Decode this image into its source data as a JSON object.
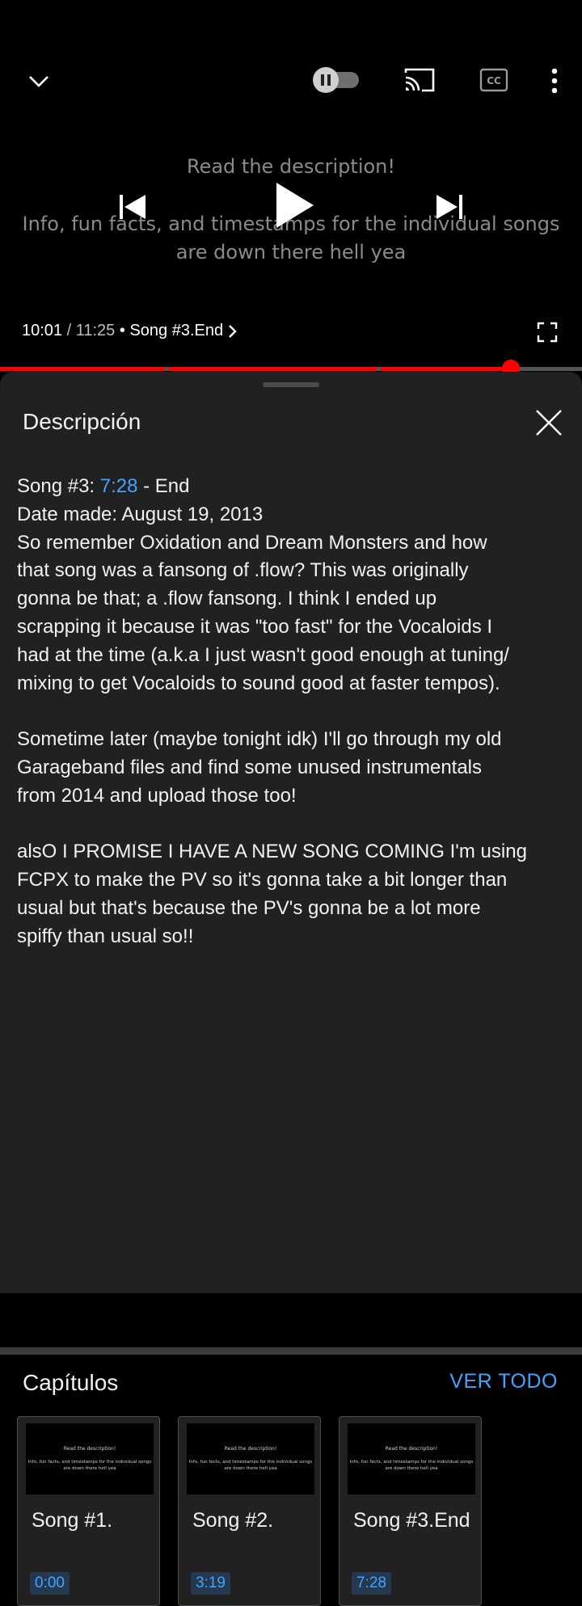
{
  "colors": {
    "accent_red": "#ff0000",
    "link_blue": "#3ea6ff",
    "panel_bg": "#212121"
  },
  "player": {
    "icons": [
      "chevron-down-icon",
      "pause-icon",
      "cast-icon",
      "closed-captions-icon",
      "more-vert-icon",
      "skip-previous-icon",
      "play-icon",
      "skip-next-icon",
      "fullscreen-icon"
    ],
    "autoplay_toggle_on": false,
    "caption_lines": [
      "Read the description!",
      "Info, fun facts, and timestamps for the individual songs",
      "are down there hell yea"
    ],
    "current_time": "10:01",
    "separator": " / ",
    "duration": "11:25",
    "chapter_bullet": " • ",
    "current_chapter": "Song #3.End",
    "progress_fraction": 0.8774
  },
  "panel": {
    "title": "Descripción",
    "description": {
      "song_prefix": "Song #3: ",
      "song_time_link": "7:28",
      "song_suffix": " - End",
      "lines": [
        "Date made: August 19, 2013",
        "So remember Oxidation and Dream Monsters and how",
        "that song was a fansong of .flow? This was originally",
        "gonna be that; a .flow fansong. I think I ended up",
        "scrapping it because it was \"too fast\" for the Vocaloids I",
        "had at the time (a.k.a I just wasn't good enough at tuning/",
        "mixing to get Vocaloids to sound good at faster tempos).",
        "",
        "Sometime later (maybe tonight idk) I'll go through my old",
        "Garageband files and find some unused instrumentals",
        "from 2014 and upload those too!",
        "",
        "alsO I PROMISE I HAVE A NEW SONG COMING I'm using",
        "FCPX to make the PV so it's gonna take a bit longer than",
        "usual but that's because the PV's gonna be a lot more",
        "spiffy than usual so!!"
      ]
    },
    "chapters_title": "Capítulos",
    "see_all": "VER TODO",
    "chapters": [
      {
        "title": "Song #1.",
        "time": "0:00",
        "thumb_line1": "Read the description!",
        "thumb_line2": "Info, fun facts, and timestamps for the individual songs",
        "thumb_line3": "are down there hell yea"
      },
      {
        "title": "Song #2.",
        "time": "3:19",
        "thumb_line1": "Read the description!",
        "thumb_line2": "Info, fun facts, and timestamps for the individual songs",
        "thumb_line3": "are down there hell yea"
      },
      {
        "title": "Song #3.End",
        "time": "7:28",
        "thumb_line1": "Read the description!",
        "thumb_line2": "Info, fun facts, and timestamps for the individual songs",
        "thumb_line3": "are down there hell yea"
      }
    ]
  }
}
